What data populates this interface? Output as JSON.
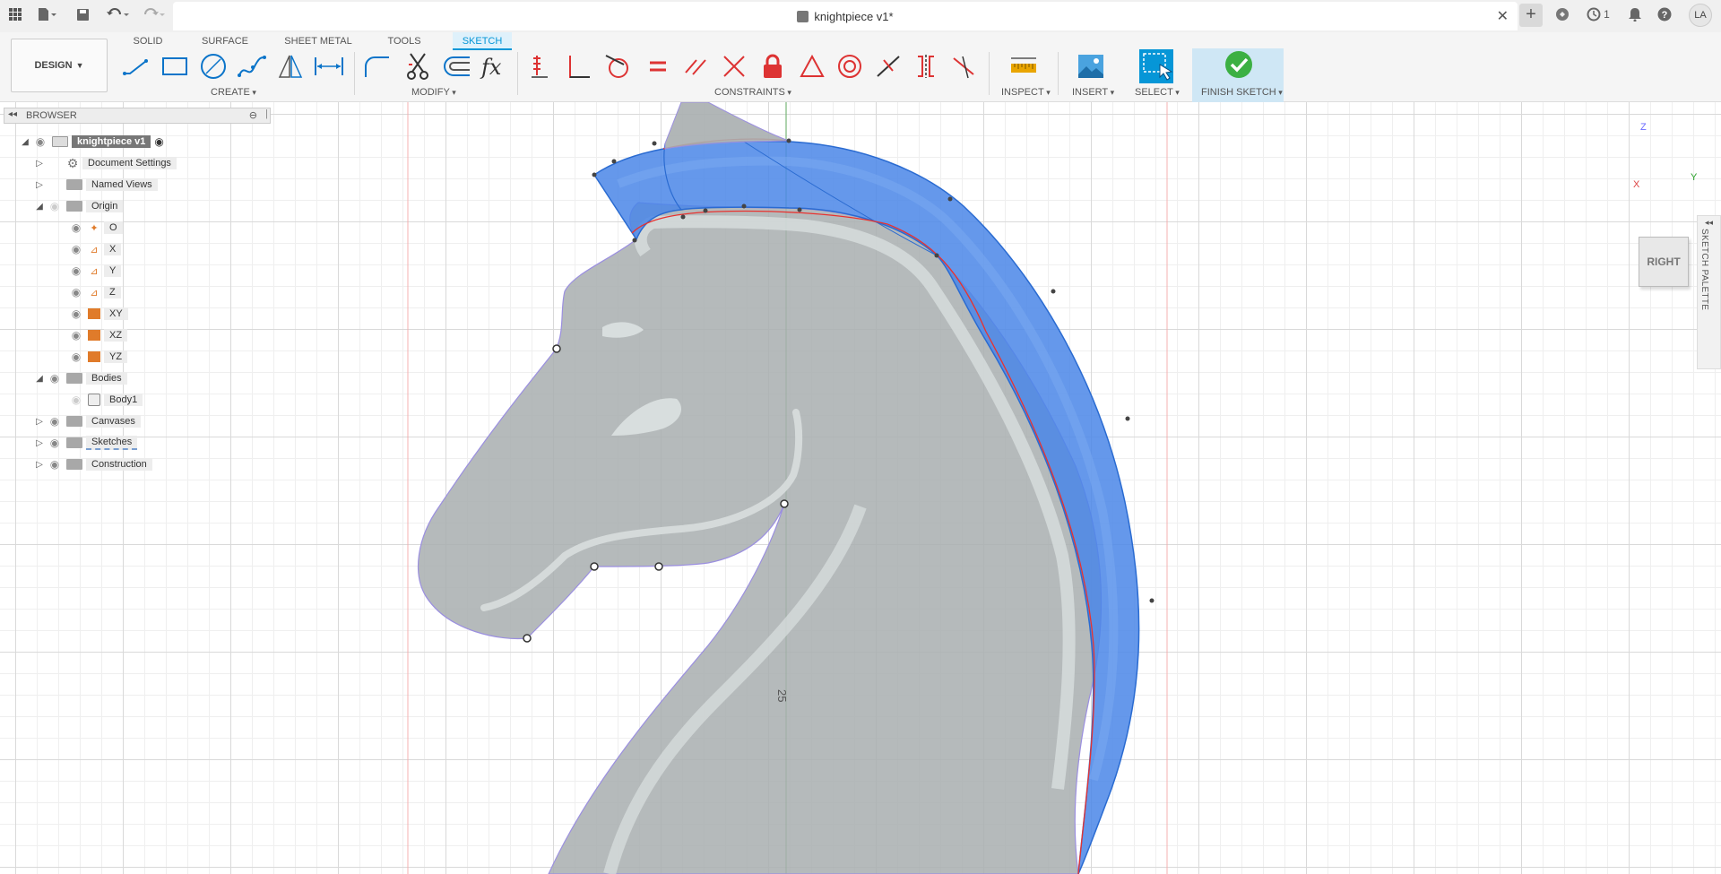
{
  "titlebar": {
    "doc_title": "knightpiece v1*",
    "job_count": "1",
    "user_initials": "LA",
    "icons": [
      "grid-icon",
      "file-icon",
      "save-icon",
      "undo-icon",
      "redo-icon",
      "close-icon",
      "plus-icon",
      "extensions-icon",
      "job-status-icon",
      "bell-icon",
      "help-icon"
    ]
  },
  "toolbar": {
    "workspace": "DESIGN",
    "tabs": [
      {
        "label": "SOLID",
        "active": false
      },
      {
        "label": "SURFACE",
        "active": false
      },
      {
        "label": "SHEET METAL",
        "active": false
      },
      {
        "label": "TOOLS",
        "active": false
      },
      {
        "label": "SKETCH",
        "active": true
      }
    ],
    "groups": {
      "create": "CREATE",
      "modify": "MODIFY",
      "constraints": "CONSTRAINTS",
      "inspect": "INSPECT",
      "insert": "INSERT",
      "select": "SELECT",
      "finish": "FINISH SKETCH"
    },
    "accent": "#0696d7"
  },
  "browser": {
    "title": "BROWSER",
    "items": [
      {
        "label": "knightpiece v1",
        "level": 0,
        "icon": "component-icon"
      },
      {
        "label": "Document Settings",
        "level": 1,
        "icon": "gear-icon"
      },
      {
        "label": "Named Views",
        "level": 1,
        "icon": "folder-icon"
      },
      {
        "label": "Origin",
        "level": 1,
        "icon": "folder-icon"
      },
      {
        "label": "O",
        "level": 2,
        "icon": "origin-point-icon"
      },
      {
        "label": "X",
        "level": 2,
        "icon": "axis-icon"
      },
      {
        "label": "Y",
        "level": 2,
        "icon": "axis-icon"
      },
      {
        "label": "Z",
        "level": 2,
        "icon": "axis-icon"
      },
      {
        "label": "XY",
        "level": 2,
        "icon": "plane-icon"
      },
      {
        "label": "XZ",
        "level": 2,
        "icon": "plane-icon"
      },
      {
        "label": "YZ",
        "level": 2,
        "icon": "plane-icon"
      },
      {
        "label": "Bodies",
        "level": 1,
        "icon": "folder-icon"
      },
      {
        "label": "Body1",
        "level": 2,
        "icon": "body-icon"
      },
      {
        "label": "Canvases",
        "level": 1,
        "icon": "folder-icon"
      },
      {
        "label": "Sketches",
        "level": 1,
        "icon": "folder-icon"
      },
      {
        "label": "Construction",
        "level": 1,
        "icon": "folder-icon"
      }
    ]
  },
  "canvas": {
    "dimension": "25",
    "viewcube_face": "RIGHT",
    "axis_labels": {
      "z": "Z",
      "y": "Y",
      "x": "X"
    },
    "palette": "SKETCH PALETTE",
    "mane_color": "#4a86e8",
    "profile_color": "#aaaaaa"
  }
}
